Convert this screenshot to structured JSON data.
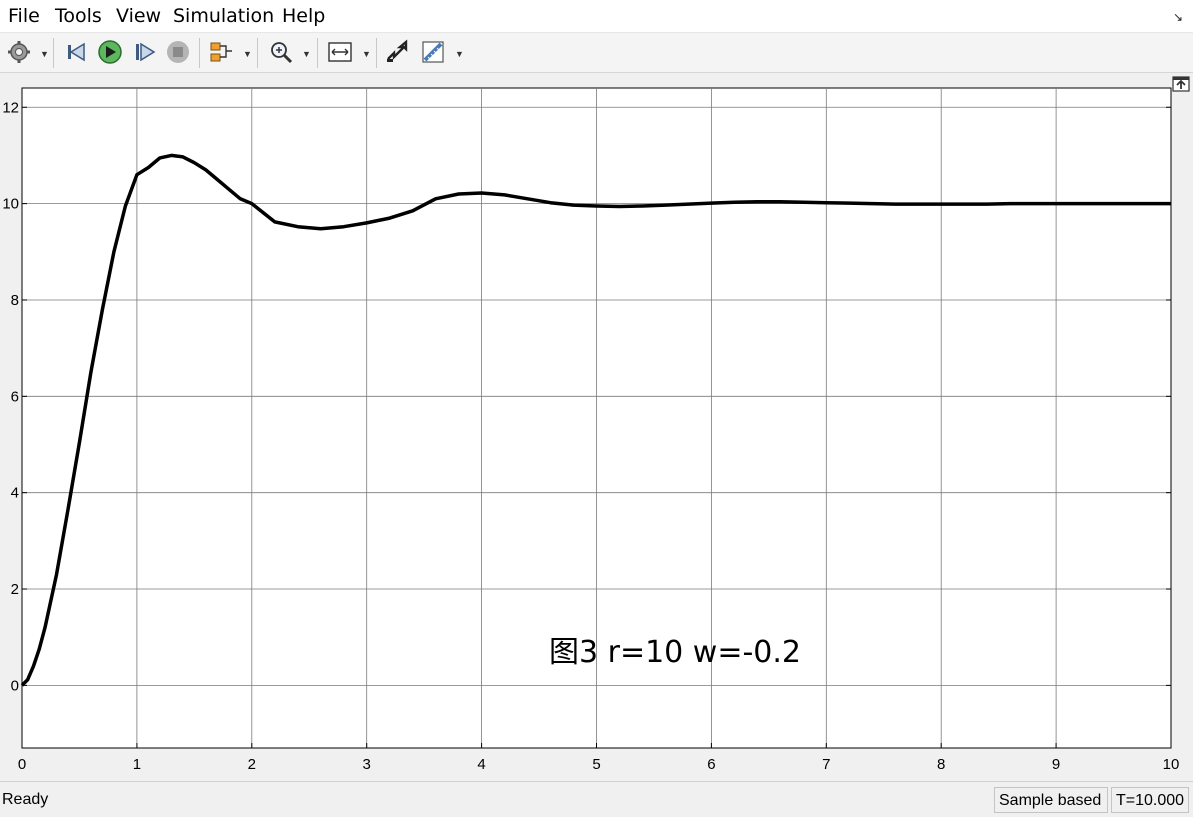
{
  "menu": {
    "file": "File",
    "tools": "Tools",
    "view": "View",
    "simulation": "Simulation",
    "help": "Help"
  },
  "toolbar": {
    "icons": [
      "gear-icon",
      "step-back-icon",
      "run-icon",
      "step-forward-icon",
      "stop-icon",
      "signal-selector-icon",
      "zoom-icon",
      "fit-axes-icon",
      "highlight-icon",
      "measure-icon"
    ]
  },
  "status": {
    "ready": "Ready",
    "sample_mode": "Sample based",
    "time": "T=10.000"
  },
  "chart_data": {
    "type": "line",
    "annotation": "图3 r=10 w=-0.2",
    "xlim": [
      0,
      10
    ],
    "ylim": [
      -1.3,
      12.4
    ],
    "x_ticks": [
      0,
      1,
      2,
      3,
      4,
      5,
      6,
      7,
      8,
      9,
      10
    ],
    "y_ticks": [
      0,
      2,
      4,
      6,
      8,
      10,
      12
    ],
    "grid": true,
    "line_color": "#000000",
    "background": "#ffffff",
    "series": [
      {
        "x": [
          0,
          0.05,
          0.1,
          0.15,
          0.2,
          0.3,
          0.4,
          0.5,
          0.6,
          0.7,
          0.8,
          0.9,
          1.0,
          1.1,
          1.2,
          1.3,
          1.4,
          1.5,
          1.6,
          1.7,
          1.8,
          1.9,
          2.0,
          2.2,
          2.4,
          2.6,
          2.8,
          3.0,
          3.2,
          3.4,
          3.6,
          3.8,
          4.0,
          4.2,
          4.4,
          4.6,
          4.8,
          5.0,
          5.2,
          5.4,
          5.6,
          5.8,
          6.0,
          6.2,
          6.4,
          6.6,
          6.8,
          7.0,
          7.2,
          7.4,
          7.6,
          7.8,
          8.0,
          8.2,
          8.4,
          8.6,
          8.8,
          9.0,
          9.2,
          9.4,
          9.6,
          9.8,
          10.0
        ],
        "y": [
          0,
          0.12,
          0.4,
          0.75,
          1.2,
          2.3,
          3.65,
          5.05,
          6.5,
          7.8,
          9.0,
          9.95,
          10.6,
          10.75,
          10.95,
          11.0,
          10.97,
          10.85,
          10.7,
          10.5,
          10.3,
          10.1,
          10.0,
          9.62,
          9.52,
          9.48,
          9.52,
          9.6,
          9.7,
          9.85,
          10.1,
          10.2,
          10.22,
          10.18,
          10.1,
          10.02,
          9.97,
          9.95,
          9.94,
          9.95,
          9.97,
          9.99,
          10.01,
          10.03,
          10.04,
          10.04,
          10.03,
          10.02,
          10.01,
          10.0,
          9.99,
          9.99,
          9.99,
          9.99,
          9.99,
          10.0,
          10.0,
          10.0,
          10.0,
          10.0,
          10.0,
          10.0,
          10.0
        ]
      }
    ]
  }
}
